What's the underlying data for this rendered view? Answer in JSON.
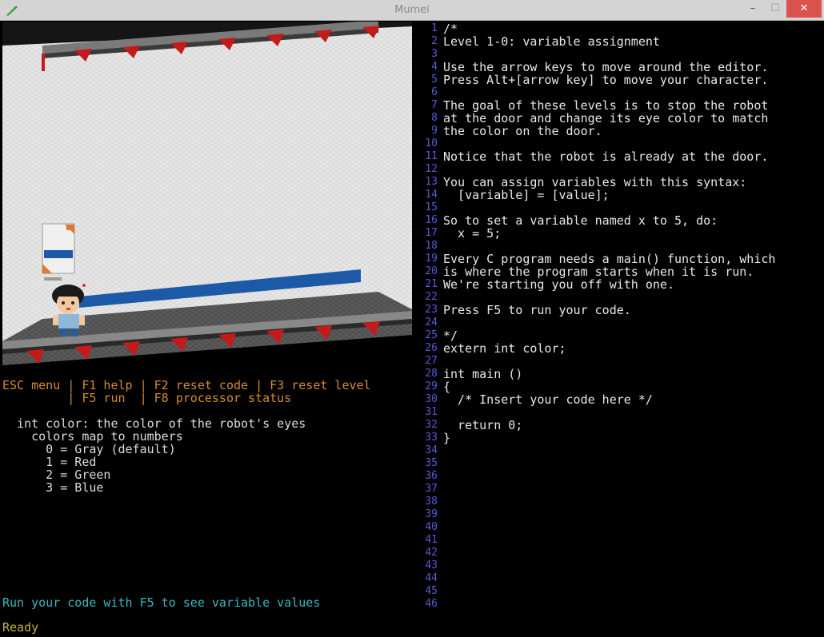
{
  "window": {
    "title": "Mumei",
    "minimize_glyph": "–",
    "maximize_glyph": "☐",
    "close_glyph": "✕",
    "icon": "app-leaf-icon"
  },
  "console": {
    "menu_line1": "ESC menu | F1 help | F2 reset code | F3 reset level",
    "menu_line2": "         | F5 run  | F8 processor status",
    "var_desc": "  int color: the color of the robot's eyes",
    "colors_map": "    colors map to numbers",
    "color0": "      0 = Gray (default)",
    "color1": "      1 = Red",
    "color2": "      2 = Green",
    "color3": "      3 = Blue",
    "run_hint": "Run your code with F5 to see variable values",
    "status": "Ready"
  },
  "editor": {
    "line_numbers": [
      "1",
      "2",
      "3",
      "4",
      "5",
      "6",
      "7",
      "8",
      "9",
      "10",
      "11",
      "12",
      "13",
      "14",
      "15",
      "16",
      "17",
      "18",
      "19",
      "20",
      "21",
      "22",
      "23",
      "24",
      "25",
      "26",
      "27",
      "28",
      "29",
      "30",
      "31",
      "32",
      "33",
      "34",
      "35",
      "36",
      "37",
      "38",
      "39",
      "40",
      "41",
      "42",
      "43",
      "44",
      "45",
      "46"
    ],
    "lines": [
      "/*",
      "Level 1-0: variable assignment",
      "",
      "Use the arrow keys to move around the editor.",
      "Press Alt+[arrow key] to move your character.",
      "",
      "The goal of these levels is to stop the robot",
      "at the door and change its eye color to match",
      "the color on the door.",
      "",
      "Notice that the robot is already at the door.",
      "",
      "You can assign variables with this syntax:",
      "  [variable] = [value];",
      "",
      "So to set a variable named x to 5, do:",
      "  x = 5;",
      "",
      "Every C program needs a main() function, which",
      "is where the program starts when it is run.",
      "We're starting you off with one.",
      "",
      "Press F5 to run your code.",
      "",
      "*/",
      "extern int color;",
      "",
      "int main ()",
      "{",
      "  /* Insert your code here */",
      "  ",
      "  return 0;",
      "}"
    ]
  },
  "colors": {
    "menu_text": "#d58a30",
    "hint_text": "#3bb6c0",
    "status_text": "#c8b33a",
    "line_number": "#5a5ad8",
    "door_stripe": "#1c5aa8",
    "triangles": "#c41a1a"
  }
}
